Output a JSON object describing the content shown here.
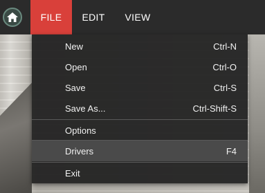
{
  "menubar": {
    "home_icon": "home-icon",
    "tabs": [
      {
        "label": "FILE",
        "active": true
      },
      {
        "label": "EDIT",
        "active": false
      },
      {
        "label": "VIEW",
        "active": false
      }
    ],
    "accent_color": "#d9403a"
  },
  "dropdown": {
    "items": [
      {
        "label": "New",
        "shortcut": "Ctrl-N"
      },
      {
        "label": "Open",
        "shortcut": "Ctrl-O"
      },
      {
        "label": "Save",
        "shortcut": "Ctrl-S"
      },
      {
        "label": "Save As...",
        "shortcut": "Ctrl-Shift-S"
      },
      {
        "label": "Options",
        "shortcut": ""
      },
      {
        "label": "Drivers",
        "shortcut": "F4"
      },
      {
        "label": "Exit",
        "shortcut": ""
      }
    ],
    "highlighted_item": "Drivers"
  }
}
